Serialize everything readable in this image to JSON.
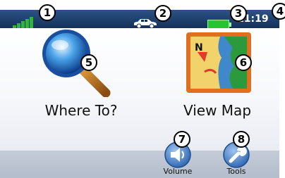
{
  "status_bar": {
    "clock": "11:19",
    "signal_icon": "gps-signal-icon",
    "vehicle_icon": "vehicle-icon",
    "battery_icon": "battery-icon",
    "colors": {
      "bar": "#1e3e6c",
      "signal": "#2fb43c",
      "battery": "#27c431"
    }
  },
  "main_menu": {
    "where_to": {
      "label": "Where To?",
      "icon": "magnifier-icon"
    },
    "view_map": {
      "label": "View Map",
      "icon": "map-icon"
    }
  },
  "bottom_bar": {
    "volume": {
      "label": "Volume",
      "icon": "speaker-icon"
    },
    "tools": {
      "label": "Tools",
      "icon": "wrench-icon"
    }
  },
  "callouts": [
    "1",
    "2",
    "3",
    "4",
    "5",
    "6",
    "7",
    "8"
  ]
}
